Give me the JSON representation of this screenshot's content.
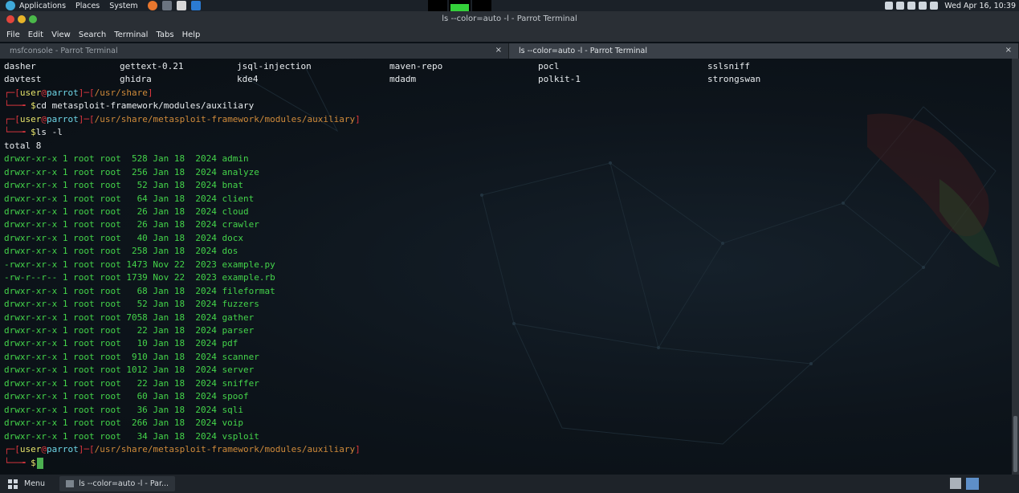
{
  "top_panel": {
    "applications": "Applications",
    "places": "Places",
    "system": "System",
    "clock": "Wed Apr 16, 10:39"
  },
  "window": {
    "title": "ls --color=auto -l - Parrot Terminal",
    "menu": [
      "File",
      "Edit",
      "View",
      "Search",
      "Terminal",
      "Tabs",
      "Help"
    ],
    "tabs": [
      {
        "label": "msfconsole - Parrot Terminal",
        "close": "×"
      },
      {
        "label": "ls --color=auto -l - Parrot Terminal",
        "close": "×"
      }
    ]
  },
  "terminal": {
    "listing_rows": [
      [
        "dasher",
        "gettext-0.21",
        "jsql-injection",
        "maven-repo",
        "pocl",
        "sslsniff"
      ],
      [
        "davtest",
        "ghidra",
        "kde4",
        "mdadm",
        "polkit-1",
        "strongswan"
      ]
    ],
    "prompt_user": "user",
    "prompt_at": "@",
    "prompt_host": "parrot",
    "cwd1": "/usr/share",
    "cmd1": "cd metasploit-framework/modules/auxiliary",
    "cwd2": "/usr/share/metasploit-framework/modules/auxiliary",
    "cmd2": "ls -l",
    "total": "total 8",
    "entries": [
      {
        "perm": "drwxr-xr-x",
        "size": " 528",
        "month": "Jan",
        "day": "18",
        "year": "2024",
        "name": "admin",
        "type": "dir"
      },
      {
        "perm": "drwxr-xr-x",
        "size": " 256",
        "month": "Jan",
        "day": "18",
        "year": "2024",
        "name": "analyze",
        "type": "dir"
      },
      {
        "perm": "drwxr-xr-x",
        "size": "  52",
        "month": "Jan",
        "day": "18",
        "year": "2024",
        "name": "bnat",
        "type": "dir"
      },
      {
        "perm": "drwxr-xr-x",
        "size": "  64",
        "month": "Jan",
        "day": "18",
        "year": "2024",
        "name": "client",
        "type": "dir"
      },
      {
        "perm": "drwxr-xr-x",
        "size": "  26",
        "month": "Jan",
        "day": "18",
        "year": "2024",
        "name": "cloud",
        "type": "dir"
      },
      {
        "perm": "drwxr-xr-x",
        "size": "  26",
        "month": "Jan",
        "day": "18",
        "year": "2024",
        "name": "crawler",
        "type": "dir"
      },
      {
        "perm": "drwxr-xr-x",
        "size": "  40",
        "month": "Jan",
        "day": "18",
        "year": "2024",
        "name": "docx",
        "type": "dir"
      },
      {
        "perm": "drwxr-xr-x",
        "size": " 258",
        "month": "Jan",
        "day": "18",
        "year": "2024",
        "name": "dos",
        "type": "dir"
      },
      {
        "perm": "-rwxr-xr-x",
        "size": "1473",
        "month": "Nov",
        "day": "22",
        "year": "2023",
        "name": "example.py",
        "type": "exec"
      },
      {
        "perm": "-rw-r--r--",
        "size": "1739",
        "month": "Nov",
        "day": "22",
        "year": "2023",
        "name": "example.rb",
        "type": "file"
      },
      {
        "perm": "drwxr-xr-x",
        "size": "  68",
        "month": "Jan",
        "day": "18",
        "year": "2024",
        "name": "fileformat",
        "type": "dir"
      },
      {
        "perm": "drwxr-xr-x",
        "size": "  52",
        "month": "Jan",
        "day": "18",
        "year": "2024",
        "name": "fuzzers",
        "type": "dir"
      },
      {
        "perm": "drwxr-xr-x",
        "size": "7058",
        "month": "Jan",
        "day": "18",
        "year": "2024",
        "name": "gather",
        "type": "dir"
      },
      {
        "perm": "drwxr-xr-x",
        "size": "  22",
        "month": "Jan",
        "day": "18",
        "year": "2024",
        "name": "parser",
        "type": "dir"
      },
      {
        "perm": "drwxr-xr-x",
        "size": "  10",
        "month": "Jan",
        "day": "18",
        "year": "2024",
        "name": "pdf",
        "type": "dir"
      },
      {
        "perm": "drwxr-xr-x",
        "size": " 910",
        "month": "Jan",
        "day": "18",
        "year": "2024",
        "name": "scanner",
        "type": "dir"
      },
      {
        "perm": "drwxr-xr-x",
        "size": "1012",
        "month": "Jan",
        "day": "18",
        "year": "2024",
        "name": "server",
        "type": "dir"
      },
      {
        "perm": "drwxr-xr-x",
        "size": "  22",
        "month": "Jan",
        "day": "18",
        "year": "2024",
        "name": "sniffer",
        "type": "dir"
      },
      {
        "perm": "drwxr-xr-x",
        "size": "  60",
        "month": "Jan",
        "day": "18",
        "year": "2024",
        "name": "spoof",
        "type": "dir"
      },
      {
        "perm": "drwxr-xr-x",
        "size": "  36",
        "month": "Jan",
        "day": "18",
        "year": "2024",
        "name": "sqli",
        "type": "dir"
      },
      {
        "perm": "drwxr-xr-x",
        "size": " 266",
        "month": "Jan",
        "day": "18",
        "year": "2024",
        "name": "voip",
        "type": "dir"
      },
      {
        "perm": "drwxr-xr-x",
        "size": "  34",
        "month": "Jan",
        "day": "18",
        "year": "2024",
        "name": "vsploit",
        "type": "dir"
      }
    ],
    "links": "1",
    "owner": "root",
    "group": "root",
    "cwd3": "/usr/share/metasploit-framework/modules/auxiliary",
    "final_prompt_symbol": "$"
  },
  "taskbar": {
    "menu_label": "Menu",
    "task_label": "ls --color=auto -l - Par..."
  },
  "colors": {
    "dir": "#44d44a",
    "exec": "#44d44a",
    "file": "#44d44a",
    "prompt_bracket": "#e0373f",
    "path": "#cf8a3a",
    "name_highlight": "#6fd7e8"
  }
}
